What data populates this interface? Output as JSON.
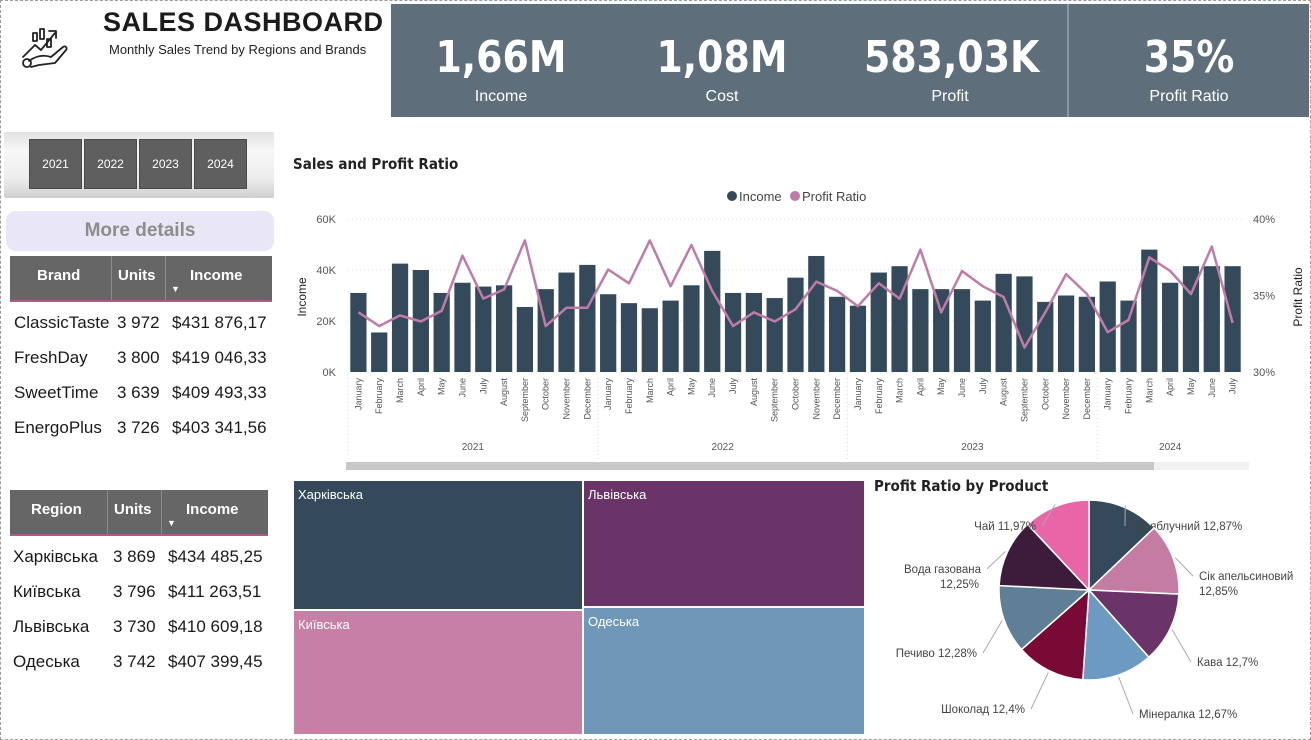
{
  "header": {
    "title": "SALES DASHBOARD",
    "subtitle": "Monthly Sales Trend by Regions and Brands"
  },
  "kpis": [
    {
      "value": "1,66M",
      "label": "Income"
    },
    {
      "value": "1,08M",
      "label": "Cost"
    },
    {
      "value": "583,03K",
      "label": "Profit"
    },
    {
      "value": "35%",
      "label": "Profit Ratio"
    }
  ],
  "year_slicer": [
    "2021",
    "2022",
    "2023",
    "2024"
  ],
  "more_details": "More details",
  "brand_table": {
    "columns": [
      "Brand",
      "Units",
      "Income"
    ],
    "rows": [
      [
        "ClassicTaste",
        "3 972",
        "$431 876,17"
      ],
      [
        "FreshDay",
        "3 800",
        "$419 046,33"
      ],
      [
        "SweetTime",
        "3 639",
        "$409 493,33"
      ],
      [
        "EnergoPlus",
        "3 726",
        "$403 341,56"
      ]
    ]
  },
  "region_table": {
    "columns": [
      "Region",
      "Units",
      "Income"
    ],
    "rows": [
      [
        "Харківська",
        "3 869",
        "$434 485,25"
      ],
      [
        "Київська",
        "3 796",
        "$411 263,51"
      ],
      [
        "Львівська",
        "3 730",
        "$410 609,18"
      ],
      [
        "Одеська",
        "3 742",
        "$407 399,45"
      ]
    ]
  },
  "colors": {
    "bar": "#344a5a",
    "line": "#c07ba8",
    "kpi_band": "#5e6e7b",
    "treemap": [
      "#344a5a",
      "#6a3468",
      "#c77fa6",
      "#6f98b8"
    ],
    "pie": [
      "#344a5a",
      "#c47ca2",
      "#6a3468",
      "#6d9ac2",
      "#780a35",
      "#5e7f96",
      "#3d1b3a",
      "#e965a8"
    ]
  },
  "chart_data": [
    {
      "type": "bar",
      "title": "Sales and Profit Ratio",
      "ylabel": "Income",
      "y2label": "Profit Ratio",
      "ylim": [
        0,
        60000
      ],
      "y_ticks": [
        "0K",
        "20K",
        "40K",
        "60K"
      ],
      "y2lim": [
        30,
        40
      ],
      "y2_ticks": [
        "30%",
        "35%",
        "40%"
      ],
      "legend_position": "top-center",
      "grid": true,
      "years": [
        "2021",
        "2022",
        "2023",
        "2024"
      ],
      "categories": [
        "January",
        "February",
        "March",
        "April",
        "May",
        "June",
        "July",
        "August",
        "September",
        "October",
        "November",
        "December",
        "January",
        "February",
        "March",
        "April",
        "May",
        "June",
        "July",
        "August",
        "September",
        "October",
        "November",
        "December",
        "January",
        "February",
        "March",
        "April",
        "May",
        "June",
        "July",
        "August",
        "September",
        "October",
        "November",
        "December",
        "January",
        "February",
        "March",
        "April",
        "May",
        "June",
        "July"
      ],
      "series": [
        {
          "name": "Income",
          "kind": "bar",
          "values": [
            31000,
            15500,
            42500,
            40000,
            31000,
            35000,
            33500,
            34000,
            25500,
            32500,
            39000,
            42000,
            30500,
            27000,
            25000,
            28000,
            34000,
            47500,
            31000,
            31000,
            29000,
            37000,
            45500,
            29500,
            26000,
            39000,
            41500,
            32500,
            32500,
            32500,
            28000,
            38500,
            37500,
            27500,
            30000,
            29500,
            35500,
            28000,
            48000,
            35000,
            41500,
            41500,
            41500
          ]
        },
        {
          "name": "Profit Ratio",
          "kind": "line",
          "values": [
            33.9,
            33.0,
            33.7,
            33.3,
            34.0,
            37.6,
            34.8,
            35.4,
            38.6,
            33.0,
            34.2,
            34.2,
            36.7,
            35.8,
            38.6,
            35.6,
            38.3,
            35.3,
            33.0,
            33.9,
            33.3,
            34.1,
            35.9,
            35.3,
            34.3,
            35.8,
            34.8,
            38.0,
            33.9,
            36.6,
            35.6,
            34.9,
            31.6,
            33.9,
            36.4,
            35.1,
            32.6,
            33.4,
            37.5,
            36.6,
            35.1,
            38.2,
            33.2
          ]
        }
      ]
    },
    {
      "type": "treemap",
      "labels": [
        "Харківська",
        "Львівська",
        "Київська",
        "Одеська"
      ],
      "values": [
        434485.25,
        410609.18,
        411263.51,
        407399.45
      ]
    },
    {
      "type": "pie",
      "title": "Profit Ratio by Product",
      "labels": [
        "Сік яблучний 12,87%",
        "Сік апельсиновий 12,85%",
        "Кава 12,7%",
        "Мінералка 12,67%",
        "Шоколад 12,4%",
        "Печиво 12,28%",
        "Вода газована 12,25%",
        "Чай 11,97%"
      ],
      "values": [
        12.87,
        12.85,
        12.7,
        12.67,
        12.4,
        12.28,
        12.25,
        11.97
      ]
    }
  ]
}
